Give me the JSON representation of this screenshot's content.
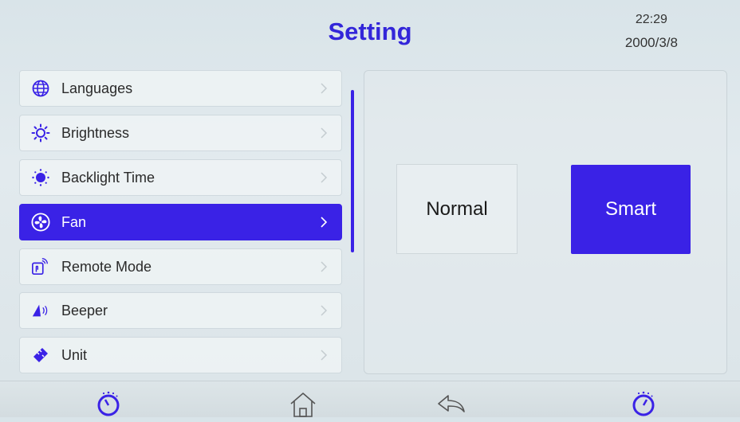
{
  "header": {
    "title": "Setting",
    "time": "22:29",
    "date": "2000/3/8"
  },
  "menu": {
    "items": [
      {
        "label": "Languages",
        "icon": "globe-icon",
        "active": false
      },
      {
        "label": "Brightness",
        "icon": "sun-icon",
        "active": false
      },
      {
        "label": "Backlight Time",
        "icon": "backlight-icon",
        "active": false
      },
      {
        "label": "Fan",
        "icon": "fan-icon",
        "active": true
      },
      {
        "label": "Remote Mode",
        "icon": "remote-icon",
        "active": false
      },
      {
        "label": "Beeper",
        "icon": "speaker-icon",
        "active": false
      },
      {
        "label": "Unit",
        "icon": "ruler-icon",
        "active": false
      }
    ]
  },
  "fan_panel": {
    "normal_label": "Normal",
    "smart_label": "Smart",
    "selected": "Smart"
  },
  "bottom_nav": {
    "items": [
      "timer-icon",
      "home-icon",
      "back-icon",
      "timer-icon"
    ]
  },
  "colors": {
    "accent": "#3a22e6",
    "title": "#3326d9"
  }
}
